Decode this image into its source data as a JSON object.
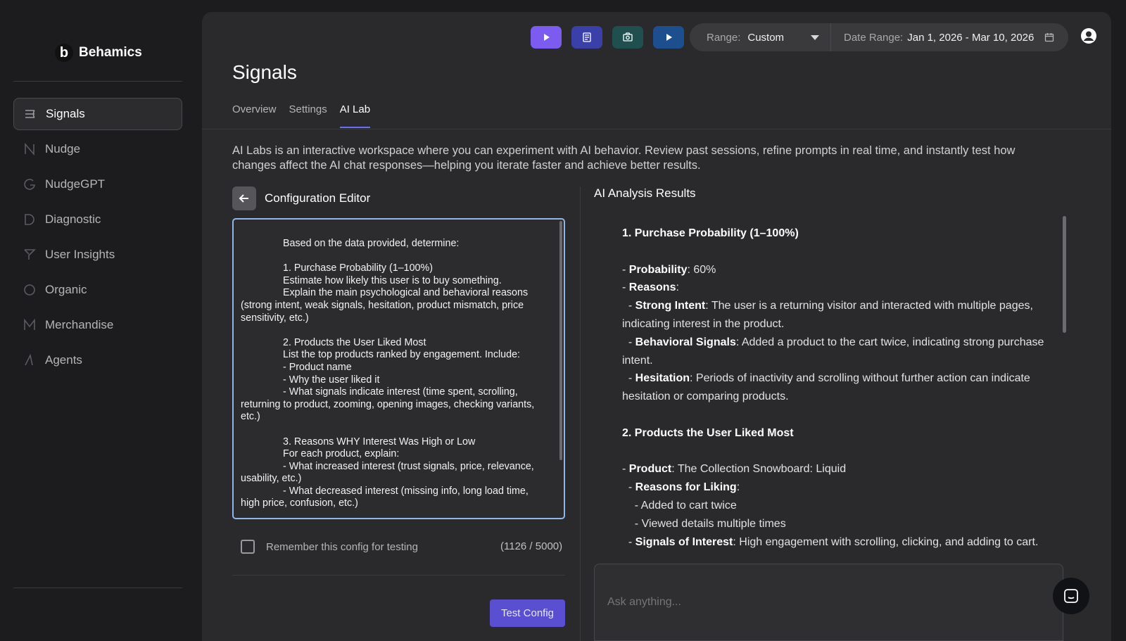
{
  "app": {
    "name": "Behamics",
    "logo_letter": "b"
  },
  "sidebar": {
    "items": [
      {
        "label": "Signals",
        "icon": "signals-icon",
        "active": true
      },
      {
        "label": "Nudge",
        "icon": "nudge-icon"
      },
      {
        "label": "NudgeGPT",
        "icon": "nudgegpt-icon"
      },
      {
        "label": "Diagnostic",
        "icon": "diagnostic-icon"
      },
      {
        "label": "User Insights",
        "icon": "user-insights-icon"
      },
      {
        "label": "Organic",
        "icon": "organic-icon"
      },
      {
        "label": "Merchandise",
        "icon": "merchandise-icon"
      },
      {
        "label": "Agents",
        "icon": "agents-icon"
      }
    ]
  },
  "toolbar": {
    "buttons": [
      {
        "icon": "play-icon",
        "color": "#7c5cf0"
      },
      {
        "icon": "document-icon",
        "color": "#3b3fa8"
      },
      {
        "icon": "camera-icon",
        "color": "#1f4f4f"
      },
      {
        "icon": "play-icon",
        "color": "#1d4f8f"
      }
    ],
    "range_label": "Range:",
    "range_value": "Custom",
    "date_label": "Date Range:",
    "date_value": "Jan 1, 2026 - Mar 10, 2026"
  },
  "page": {
    "title": "Signals",
    "tabs": [
      {
        "label": "Overview"
      },
      {
        "label": "Settings"
      },
      {
        "label": "AI Lab",
        "active": true
      }
    ],
    "intro": "AI Labs is an interactive workspace where you can experiment with AI behavior. Review past sessions, refine prompts in real time, and instantly test how changes affect the AI chat responses—helping you iterate faster and achieve better results."
  },
  "config_editor": {
    "title": "Configuration Editor",
    "lines": [
      {
        "text": "Based on the data provided, determine:",
        "indent": true
      },
      {
        "text": "",
        "indent": false
      },
      {
        "text": "1. Purchase Probability (1–100%)",
        "indent": true
      },
      {
        "text": "Estimate how likely this user is to buy something.",
        "indent": true
      },
      {
        "text": "Explain the main psychological and behavioral reasons",
        "indent": true
      },
      {
        "text": "(strong intent, weak signals, hesitation, product mismatch, price sensitivity, etc.)",
        "indent": false
      },
      {
        "text": "",
        "indent": false
      },
      {
        "text": "2. Products the User Liked Most",
        "indent": true
      },
      {
        "text": "List the top products ranked by engagement. Include:",
        "indent": true
      },
      {
        "text": "- Product name",
        "indent": true
      },
      {
        "text": "- Why the user liked it",
        "indent": true
      },
      {
        "text": "- What signals indicate interest (time spent, scrolling,",
        "indent": true
      },
      {
        "text": "returning to product, zooming, opening images, checking variants, etc.)",
        "indent": false
      },
      {
        "text": "",
        "indent": false
      },
      {
        "text": "3. Reasons WHY Interest Was High or Low",
        "indent": true
      },
      {
        "text": "For each product, explain:",
        "indent": true
      },
      {
        "text": "- What increased interest (trust signals, price, relevance,",
        "indent": true
      },
      {
        "text": "usability, etc.)",
        "indent": false
      },
      {
        "text": "- What decreased interest (missing info, long load time,",
        "indent": true
      },
      {
        "text": "high price, confusion, etc.)",
        "indent": false
      }
    ],
    "remember_label": "Remember this config for testing",
    "counter": "(1126 / 5000)",
    "test_button": "Test Config"
  },
  "results": {
    "title": "AI Analysis Results",
    "lines": [
      {
        "bold": "1. Purchase Probability (1–100%)",
        "text": ""
      },
      {
        "bold": "",
        "text": ""
      },
      {
        "prefix": "- ",
        "bold": "Probability",
        "text": ": 60%"
      },
      {
        "prefix": "- ",
        "bold": "Reasons",
        "text": ":"
      },
      {
        "prefix": "  - ",
        "bold": "Strong Intent",
        "text": ": The user is a returning visitor and interacted with multiple pages, indicating interest in the product."
      },
      {
        "prefix": "  - ",
        "bold": "Behavioral Signals",
        "text": ": Added a product to the cart twice, indicating strong purchase intent."
      },
      {
        "prefix": "  - ",
        "bold": "Hesitation",
        "text": ": Periods of inactivity and scrolling without further action can indicate hesitation or comparing products."
      },
      {
        "bold": "",
        "text": ""
      },
      {
        "bold": "2. Products the User Liked Most",
        "text": ""
      },
      {
        "bold": "",
        "text": ""
      },
      {
        "prefix": "- ",
        "bold": "Product",
        "text": ": The Collection Snowboard: Liquid"
      },
      {
        "prefix": "  - ",
        "bold": "Reasons for Liking",
        "text": ":"
      },
      {
        "prefix": "    - ",
        "bold": "",
        "text": "Added to cart twice"
      },
      {
        "prefix": "    - ",
        "bold": "",
        "text": "Viewed details multiple times"
      },
      {
        "prefix": "  - ",
        "bold": "Signals of Interest",
        "text": ": High engagement with scrolling, clicking, and adding to cart."
      }
    ],
    "ask_placeholder": "Ask anything..."
  }
}
